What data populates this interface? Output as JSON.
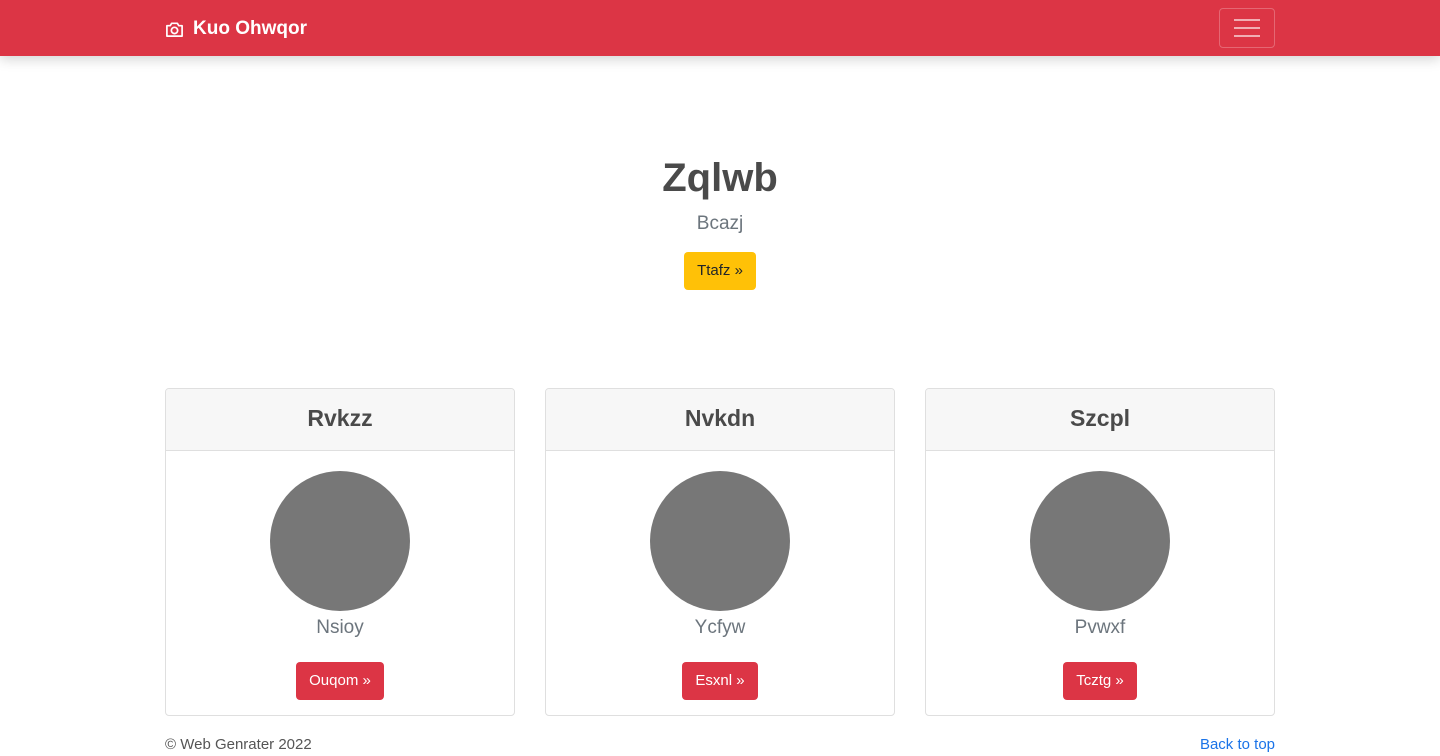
{
  "navbar": {
    "brand_icon": "camera-icon",
    "brand": "Kuo Ohwqor",
    "toggler_icon": "hamburger-menu-icon",
    "color": "#dc3545"
  },
  "hero": {
    "title": "Zqlwb",
    "subtitle": "Bcazj",
    "button": "Ttafz »",
    "button_color": "#ffc107"
  },
  "cards": [
    {
      "title": "Rvkzz",
      "name": "Nsioy",
      "button": "Ouqom »"
    },
    {
      "title": "Nvkdn",
      "name": "Ycfyw",
      "button": "Esxnl »"
    },
    {
      "title": "Szcpl",
      "name": "Pvwxf",
      "button": "Tcztg »"
    }
  ],
  "footer": {
    "copyright": "© Web Genrater 2022",
    "back_to_top": "Back to top"
  }
}
